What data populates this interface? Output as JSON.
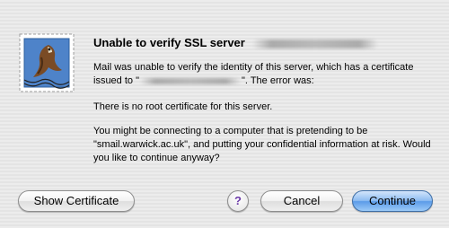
{
  "dialog": {
    "title": "Unable to verify SSL server",
    "message_part1": "Mail was unable to verify the identity of this server, which has a certificate issued to \"",
    "message_part2": "\". The error was:",
    "error": "There is no root certificate for this server.",
    "warning": "You might be connecting to a computer that is pretending to be \"smail.warwick.ac.uk\", and putting your confidential information at risk. Would you like to continue anyway?"
  },
  "buttons": {
    "show_certificate": "Show Certificate",
    "help": "?",
    "cancel": "Cancel",
    "continue": "Continue"
  },
  "icons": {
    "app": "mail-stamp-icon",
    "help": "help-icon"
  },
  "colors": {
    "default_button": "#5b9be8",
    "help_glyph": "#6b3aa8"
  }
}
